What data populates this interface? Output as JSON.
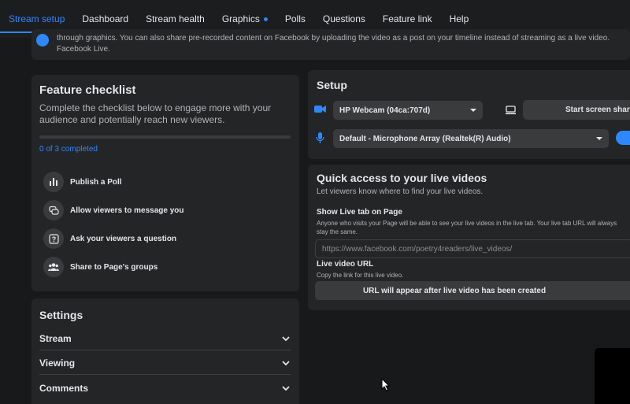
{
  "nav": {
    "tabs": [
      {
        "label": "Stream setup",
        "active": true
      },
      {
        "label": "Dashboard"
      },
      {
        "label": "Stream health"
      },
      {
        "label": "Graphics",
        "has_dot": true
      },
      {
        "label": "Polls"
      },
      {
        "label": "Questions"
      },
      {
        "label": "Feature link"
      },
      {
        "label": "Help"
      }
    ]
  },
  "banner": {
    "line1": "through graphics. You can also share pre-recorded content on Facebook by uploading the video as a post on your timeline instead of streaming as a live video.",
    "line2": "Facebook Live."
  },
  "checklist": {
    "title": "Feature checklist",
    "description": "Complete the checklist below to engage more with your audience and potentially reach new viewers.",
    "progress_text": "0 of 3 completed",
    "progress_fraction": 0,
    "tasks": [
      {
        "label": "Publish a Poll",
        "icon": "poll-icon"
      },
      {
        "label": "Allow viewers to message you",
        "icon": "message-icon"
      },
      {
        "label": "Ask your viewers a question",
        "icon": "question-icon"
      },
      {
        "label": "Share to Page's groups",
        "icon": "groups-icon"
      }
    ]
  },
  "settings": {
    "title": "Settings",
    "sections": [
      {
        "label": "Stream"
      },
      {
        "label": "Viewing"
      },
      {
        "label": "Comments"
      }
    ]
  },
  "setup": {
    "title": "Setup",
    "camera": "HP Webcam (04ca:707d)",
    "share_label": "Start screen share",
    "microphone": "Default - Microphone Array (Realtek(R) Audio)"
  },
  "quick_access": {
    "title": "Quick access to your live videos",
    "subtitle": "Let viewers know where to find your live videos.",
    "live_tab_label": "Show Live tab on Page",
    "live_tab_desc": "Anyone who visits your Page will be able to see your live videos in the live tab. Your live tab URL will always stay the same.",
    "live_tab_url": "https://www.facebook.com/poetry4readers/live_videos/",
    "live_video_url_label": "Live video URL",
    "live_video_url_desc": "Copy the link for this live video.",
    "url_placeholder_button": "URL will appear after live video has been created"
  },
  "colors": {
    "accent": "#2d88ff",
    "background": "#18191a",
    "card": "#242526"
  }
}
